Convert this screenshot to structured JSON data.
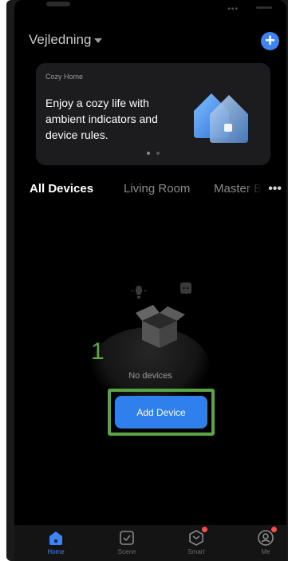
{
  "header": {
    "home_name": "Vejledning",
    "add_label": "+"
  },
  "banner": {
    "eyebrow": "Cozy Home",
    "text": "Enjoy a cozy life with ambient indicators and device rules."
  },
  "tabs": {
    "all": "All Devices",
    "living": "Living Room",
    "master": "Master Bedroom",
    "more": "•••"
  },
  "empty_state": {
    "step_number": "1",
    "message": "No devices",
    "button_label": "Add Device"
  },
  "tabbar": {
    "items": [
      {
        "label": "Home",
        "icon": "home-icon",
        "active": true
      },
      {
        "label": "Scene",
        "icon": "scene-icon",
        "active": false
      },
      {
        "label": "Smart",
        "icon": "smart-icon",
        "active": false,
        "badge": true
      },
      {
        "label": "Me",
        "icon": "me-icon",
        "active": false,
        "badge": true
      }
    ]
  },
  "colors": {
    "accent": "#3f84f0",
    "highlight": "#5aa446",
    "background": "#000000",
    "badge": "#ff4d4f"
  }
}
